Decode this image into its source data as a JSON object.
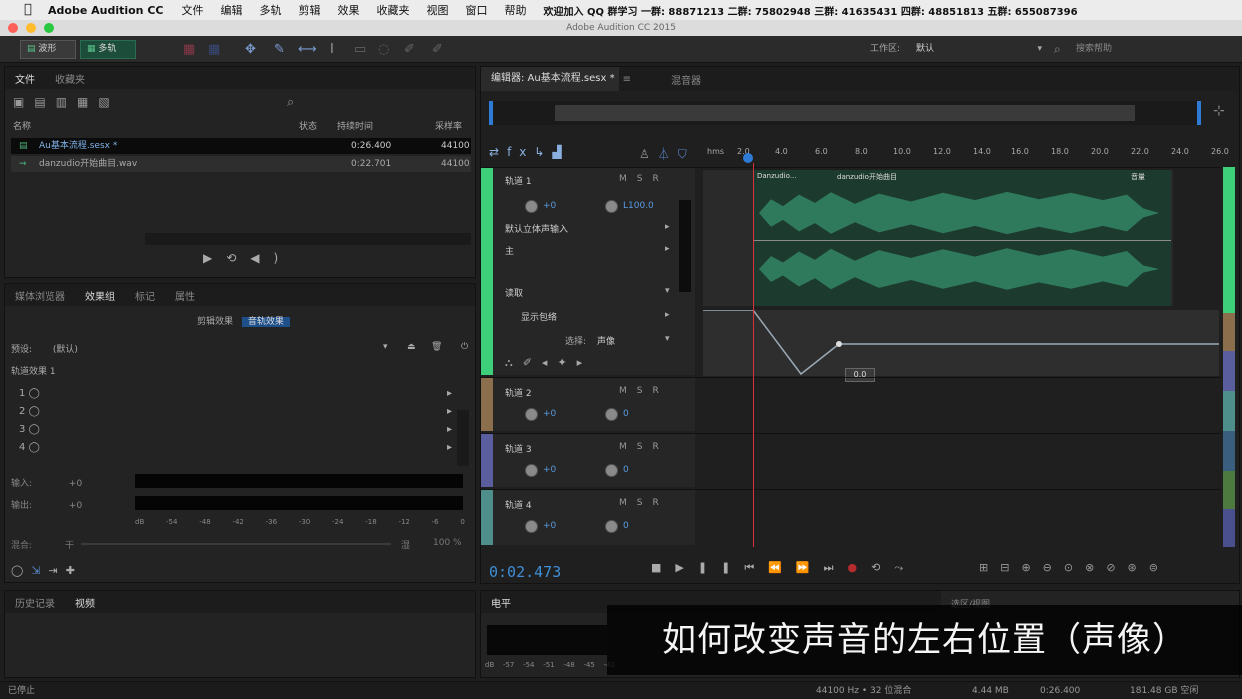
{
  "menubar": {
    "app": "Adobe Audition CC",
    "items": [
      "文件",
      "编辑",
      "多轨",
      "剪辑",
      "效果",
      "收藏夹",
      "视图",
      "窗口",
      "帮助"
    ],
    "qq": "欢迎加入 QQ 群学习 一群: 88871213 二群: 75802948 三群: 41635431 四群: 48851813 五群: 655087396"
  },
  "window": {
    "title": "Adobe Audition CC 2015"
  },
  "toolbar": {
    "waveform_label": "波形",
    "multitrack_label": "多轨",
    "workspace_label": "工作区:",
    "workspace_value": "默认",
    "search_help": "搜索帮助"
  },
  "files_panel": {
    "tabs": [
      "文件",
      "收藏夹"
    ],
    "columns": [
      "名称",
      "状态",
      "持续时间",
      "采样率"
    ],
    "files": [
      {
        "name": "Au基本流程.sesx *",
        "duration": "0:26.400",
        "rate": "44100"
      },
      {
        "name": "danzudio开始曲目.wav",
        "duration": "0:22.701",
        "rate": "44100"
      }
    ]
  },
  "effects_panel": {
    "tabs": [
      "媒体浏览器",
      "效果组",
      "标记",
      "属性"
    ],
    "sub_tabs": [
      "剪辑效果",
      "音轨效果"
    ],
    "preset_label": "预设:",
    "preset_value": "(默认)",
    "rack_label": "轨道效果 1",
    "slots": [
      "1",
      "2",
      "3",
      "4"
    ],
    "input_label": "输入:",
    "output_label": "输出:",
    "db_value": "+0",
    "mix_label": "混合:",
    "mix_left": "干",
    "mix_right": "湿",
    "mix_value": "100 %",
    "scale": [
      "dB",
      "-54",
      "-48",
      "-42",
      "-36",
      "-30",
      "-24",
      "-18",
      "-12",
      "-6",
      "0"
    ]
  },
  "history_panel": {
    "tabs": [
      "历史记录",
      "视频"
    ]
  },
  "editor": {
    "tab": "编辑器: Au基本流程.sesx *",
    "mixer_tab": "混音器",
    "time": "0:02.473",
    "ruler": [
      "hms",
      "2.0",
      "4.0",
      "6.0",
      "8.0",
      "10.0",
      "12.0",
      "14.0",
      "16.0",
      "18.0",
      "20.0",
      "22.0",
      "24.0",
      "26.0"
    ],
    "clip1": "Danzudio...",
    "clip2": "danzudio开始曲目",
    "clip3": "音量"
  },
  "tracks": [
    {
      "name": "轨道 1",
      "vol": "+0",
      "pan": "L100.0",
      "input": "默认立体声输入",
      "output": "主",
      "auto_mode": "读取",
      "auto_sel": "显示包络",
      "param_label": "选择:",
      "param_value": "声像"
    },
    {
      "name": "轨道 2",
      "vol": "+0",
      "pan": "0"
    },
    {
      "name": "轨道 3",
      "vol": "+0",
      "pan": "0"
    },
    {
      "name": "轨道 4",
      "vol": "+0",
      "pan": "0"
    }
  ],
  "tooltip": "0.0",
  "meters_panel": {
    "tab": "电平",
    "scale": [
      "dB",
      "-57",
      "-54",
      "-51",
      "-48",
      "-45",
      "-42"
    ]
  },
  "selection_panel": {
    "tab": "选区/视图"
  },
  "subtitle": "如何改变声音的左右位置（声像）",
  "statusbar": {
    "left": "已停止",
    "rate": "44100 Hz • 32 位混合",
    "size": "4.44 MB",
    "dur": "0:26.400",
    "free": "181.48 GB 空闲"
  },
  "colors": {
    "accent": "#2e7bd6",
    "time": "#3f8fd8",
    "track1": "#3ecf7a",
    "track2": "#8b6e4c",
    "track3": "#5a5e9e",
    "track4": "#4f8f8b",
    "waveform": "#2f7a5d",
    "playhead": "#d8313a"
  }
}
